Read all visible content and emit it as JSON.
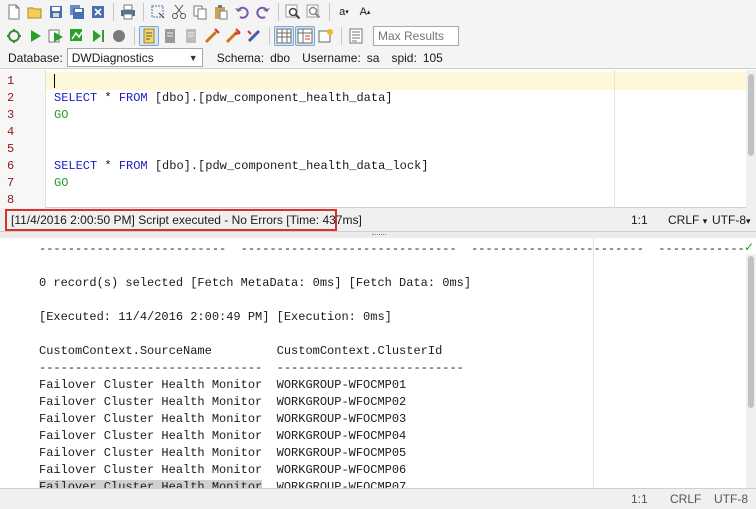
{
  "toolbar": {
    "row1_icons": [
      "new-file-icon",
      "open-folder-icon",
      "save-icon",
      "save-all-icon",
      "close-icon",
      "print-icon",
      "select-icon",
      "cut-icon",
      "copy-icon",
      "paste-icon",
      "undo-icon",
      "redo-icon",
      "find-icon",
      "replace-icon",
      "lowercase-icon",
      "uppercase-icon"
    ],
    "lowercase_label": "a",
    "uppercase_label": "A",
    "max_results_placeholder": "Max Results"
  },
  "database": {
    "label": "Database:",
    "value": "DWDiagnostics",
    "schema_label": "Schema:",
    "schema_value": "dbo",
    "username_label": "Username:",
    "username_value": "sa",
    "spid_label": "spid:",
    "spid_value": "105"
  },
  "editor": {
    "line_numbers": [
      "1",
      "2",
      "3",
      "4",
      "5",
      "6",
      "7",
      "8"
    ],
    "line2_kw1": "SELECT",
    "line2_star": " * ",
    "line2_kw2": "FROM",
    "line2_rest": " [dbo].[pdw_component_health_data]",
    "line3": "GO",
    "line6_kw1": "SELECT",
    "line6_star": " * ",
    "line6_kw2": "FROM",
    "line6_rest": " [dbo].[pdw_component_health_data_lock]",
    "line7": "GO"
  },
  "status_top": {
    "message": "[11/4/2016 2:00:50 PM] Script executed - No Errors [Time: 437ms]",
    "position": "1:1",
    "line_ending": "CRLF",
    "line_ending_arrow": "▾",
    "encoding": "UTF-8",
    "encoding_arrow": "▾"
  },
  "results": {
    "dash_line": "--------------------------  ------------------------------  ------------------------  ------------",
    "records": "0 record(s) selected [Fetch MetaData: 0ms] [Fetch Data: 0ms]",
    "executed": "[Executed: 11/4/2016 2:00:49 PM] [Execution: 0ms]",
    "header": "CustomContext.SourceName         CustomContext.ClusterId",
    "header_dashes": "-------------------------------  --------------------------",
    "rows": [
      "Failover Cluster Health Monitor  WORKGROUP-WFOCMP01",
      "Failover Cluster Health Monitor  WORKGROUP-WFOCMP02",
      "Failover Cluster Health Monitor  WORKGROUP-WFOCMP03",
      "Failover Cluster Health Monitor  WORKGROUP-WFOCMP04",
      "Failover Cluster Health Monitor  WORKGROUP-WFOCMP05",
      "Failover Cluster Health Monitor  WORKGROUP-WFOCMP06"
    ],
    "last_row_selected": "Failover Cluster Health Monitor",
    "last_row_rest": "  WORKGROUP-WFOCMP07",
    "check": "✓"
  },
  "status_bottom": {
    "position": "1:1",
    "line_ending": "CRLF",
    "encoding": "UTF-8"
  }
}
